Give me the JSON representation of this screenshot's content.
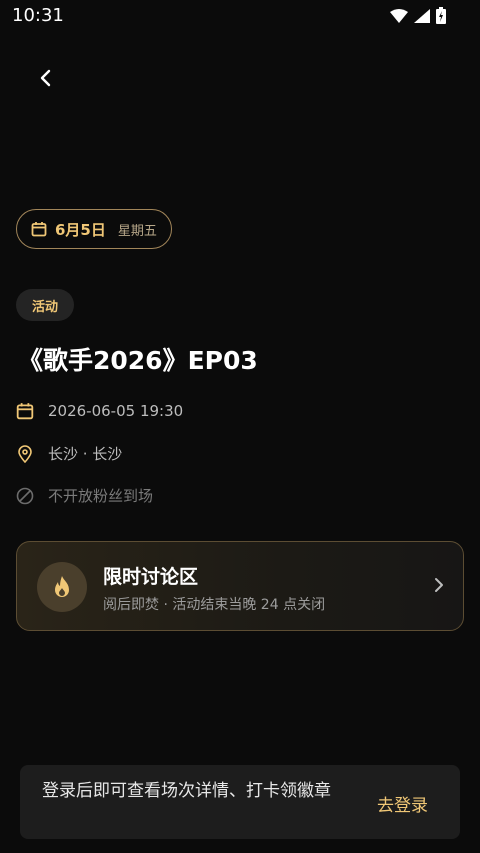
{
  "status_bar": {
    "time": "10:31"
  },
  "event": {
    "date": "6月5日",
    "weekday": "星期五",
    "tag": "活动",
    "title": "《歌手2026》EP03",
    "datetime": "2026-06-05 19:30",
    "location": "长沙 · 长沙",
    "fan_policy": "不开放粉丝到场"
  },
  "discussion_card": {
    "title": "限时讨论区",
    "subtitle": "阅后即焚 · 活动结束当晚 24 点关闭"
  },
  "login_bar": {
    "message": "登录后即可查看场次详情、打卡领徽章",
    "button": "去登录"
  },
  "colors": {
    "accent": "#f0c776",
    "background": "#0b0b0b",
    "pill_border": "#a2865a"
  }
}
